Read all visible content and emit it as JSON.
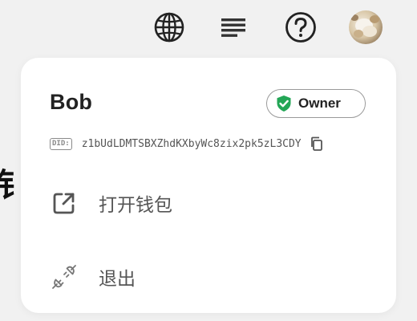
{
  "background": {
    "partial_text": "钊"
  },
  "topbar": {
    "icons": [
      "globe-icon",
      "list-icon",
      "help-icon",
      "avatar"
    ]
  },
  "account_menu": {
    "user_name": "Bob",
    "role_badge": "Owner",
    "did_tag": "DID:",
    "did_value": "z1bUdLDMTSBXZhdKXbyWc8zix2pk5zL3CDY",
    "items": [
      {
        "label": "打开钱包",
        "icon": "external-link-icon"
      },
      {
        "label": "退出",
        "icon": "plug-disconnect-icon"
      }
    ]
  },
  "colors": {
    "page_background": "#f1f1f1",
    "card_background": "#ffffff",
    "shield_green": "#23a656",
    "icon_gray": "#555555"
  }
}
